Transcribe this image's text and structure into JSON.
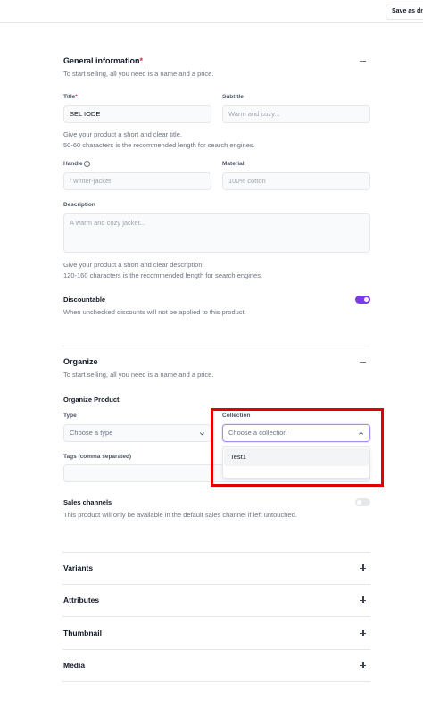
{
  "topbar": {
    "save_draft_label": "Save as draft"
  },
  "general": {
    "title": "General information",
    "required_mark": "*",
    "subtitle": "To start selling, all you need is a name and a price.",
    "title_label": "Title",
    "title_required": "*",
    "title_value": "SEL IODE",
    "subtitle_label": "Subtitle",
    "subtitle_placeholder": "Warm and cozy...",
    "title_hint_1": "Give your product a short and clear title.",
    "title_hint_2": "50-60 characters is the recommended length for search engines.",
    "handle_label": "Handle",
    "handle_placeholder": "/ winter-jacket",
    "material_label": "Material",
    "material_placeholder": "100% cotton",
    "description_label": "Description",
    "description_placeholder": "A warm and cozy jacket...",
    "description_hint_1": "Give your product a short and clear description.",
    "description_hint_2": "120-160 characters is the recommended length for search engines.",
    "discountable_label": "Discountable",
    "discountable_hint": "When unchecked discounts will not be applied to this product.",
    "discountable_on": true
  },
  "organize": {
    "title": "Organize",
    "subtitle": "To start selling, all you need is a name and a price.",
    "product_heading": "Organize Product",
    "type_label": "Type",
    "type_placeholder": "Choose a type",
    "collection_label": "Collection",
    "collection_placeholder": "Choose a collection",
    "collection_options": [
      "Test1"
    ],
    "tags_label": "Tags (comma separated)",
    "sales_channels_label": "Sales channels",
    "sales_channels_hint": "This product will only be available in the default sales channel if left untouched.",
    "sales_channels_on": false
  },
  "accordions": [
    {
      "label": "Variants"
    },
    {
      "label": "Attributes"
    },
    {
      "label": "Thumbnail"
    },
    {
      "label": "Media"
    }
  ],
  "colors": {
    "accent": "#7c3aed",
    "highlight": "#e00000"
  }
}
